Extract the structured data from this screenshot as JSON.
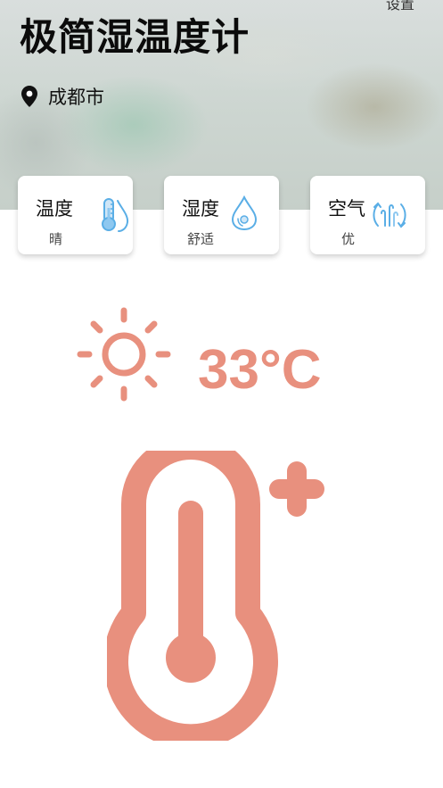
{
  "app": {
    "title": "极简湿温度计",
    "settings_label": "设置"
  },
  "location": {
    "city": "成都市",
    "icon": "location-pin-icon"
  },
  "cards": [
    {
      "title": "温度",
      "subtitle": "晴",
      "icon": "thermometer-drop-icon"
    },
    {
      "title": "湿度",
      "subtitle": "舒适",
      "icon": "water-drop-icon"
    },
    {
      "title": "空气",
      "subtitle": "优",
      "icon": "air-quality-icon"
    }
  ],
  "weather": {
    "temperature": "33°C",
    "icon": "sun-icon",
    "big_icon": "thermometer-plus-icon"
  },
  "colors": {
    "accent": "#e8907e",
    "icon_blue": "#5aaee6",
    "icon_blue_light": "#cfe6f7"
  }
}
